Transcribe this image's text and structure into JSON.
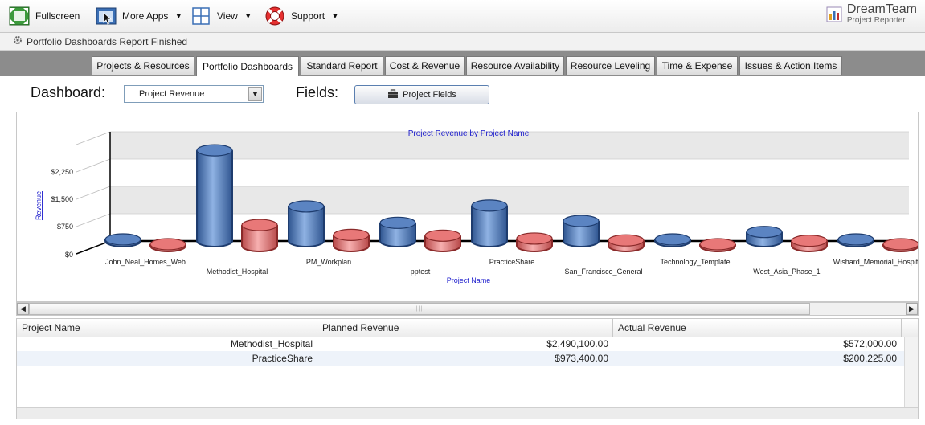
{
  "toolbar": {
    "fullscreen_label": "Fullscreen",
    "more_apps_label": "More Apps",
    "view_label": "View",
    "support_label": "Support",
    "brand_title": "DreamTeam",
    "brand_subtitle": "Project Reporter"
  },
  "status": {
    "message": "Portfolio Dashboards Report Finished"
  },
  "tabs": [
    {
      "label": "Projects & Resources",
      "active": false
    },
    {
      "label": "Portfolio Dashboards",
      "active": true
    },
    {
      "label": "Standard Report",
      "active": false
    },
    {
      "label": "Cost & Revenue",
      "active": false
    },
    {
      "label": "Resource Availability",
      "active": false
    },
    {
      "label": "Resource Leveling",
      "active": false
    },
    {
      "label": "Time & Expense",
      "active": false
    },
    {
      "label": "Issues & Action Items",
      "active": false
    }
  ],
  "dashboard": {
    "label": "Dashboard:",
    "selected": "Project Revenue",
    "fields_label": "Fields:",
    "fields_button": "Project Fields"
  },
  "chart_data": {
    "type": "bar",
    "title": "Project Revenue by Project Name",
    "xlabel": "Project Name",
    "ylabel": "Revenue",
    "y_ticks": [
      "$0",
      "$750",
      "$1,500",
      "$2,250"
    ],
    "ylim": [
      0,
      3000
    ],
    "categories": [
      "John_Neal_Homes_Web",
      "Methodist_Hospital",
      "PM_Workplan",
      "pptest",
      "PracticeShare",
      "San_Francisco_General",
      "Technology_Template",
      "West_Asia_Phase_1",
      "Wishard_Memorial_Hospital"
    ],
    "series": [
      {
        "values": [
          0,
          2490.1,
          950,
          500,
          973.4,
          550,
          0,
          250,
          0
        ]
      },
      {
        "values": [
          0,
          572,
          300,
          280,
          200.225,
          150,
          0,
          140,
          0
        ]
      }
    ],
    "colors": [
      "#5b84c2",
      "#e87878"
    ],
    "grid": true
  },
  "table": {
    "columns": [
      "Project Name",
      "Planned Revenue",
      "Actual Revenue"
    ],
    "rows": [
      [
        "Methodist_Hospital",
        "$2,490,100.00",
        "$572,000.00"
      ],
      [
        "PracticeShare",
        "$973,400.00",
        "$200,225.00"
      ]
    ]
  }
}
